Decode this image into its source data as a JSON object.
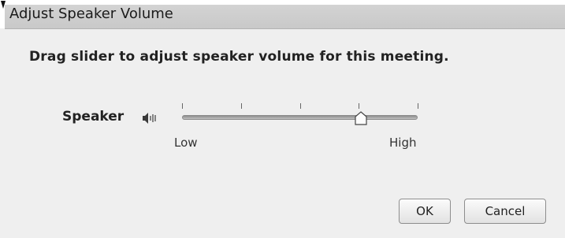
{
  "window": {
    "title": "Adjust Speaker Volume"
  },
  "dialog": {
    "instruction": "Drag slider to adjust speaker volume for this meeting.",
    "speaker_label": "Speaker",
    "speaker_icon": "speaker-icon",
    "slider": {
      "min_label": "Low",
      "max_label": "High",
      "tick_count": 5,
      "value_fraction": 0.76
    },
    "buttons": {
      "ok_label": "OK",
      "cancel_label": "Cancel"
    }
  }
}
